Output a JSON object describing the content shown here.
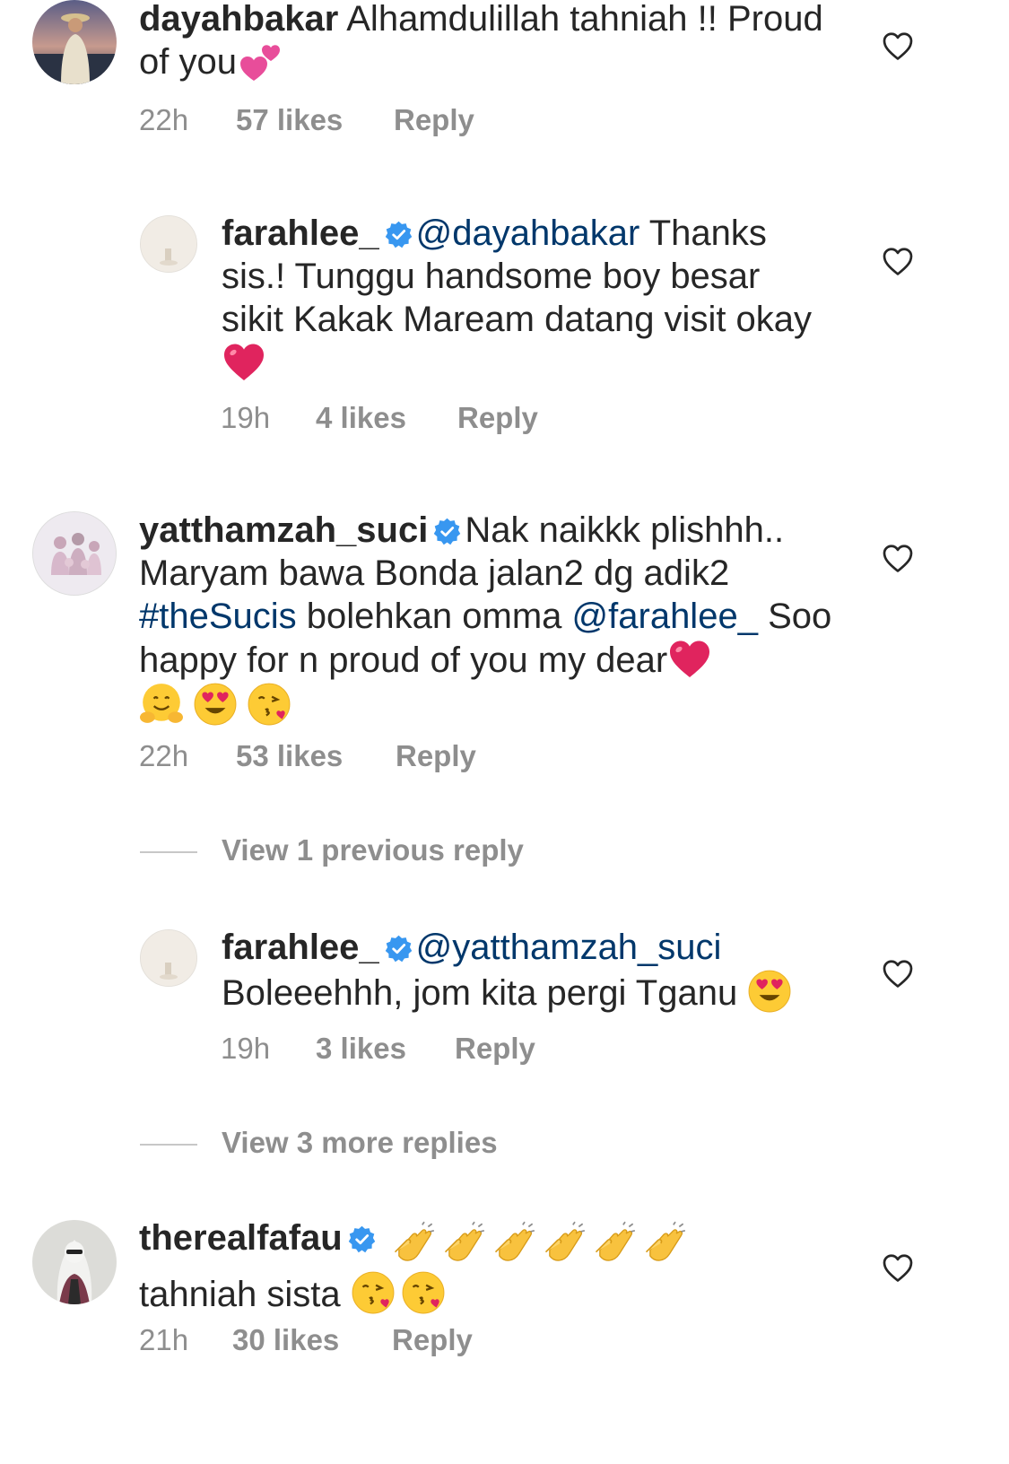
{
  "comments": [
    {
      "username": "dayahbakar",
      "text": "Alhamdulillah tahniah !! Proud of you",
      "time": "22h",
      "likes": "57 likes",
      "reply": "Reply"
    },
    {
      "username": "farahlee_",
      "mention": "@dayahbakar",
      "text": "Thanks sis.! Tunggu handsome boy besar sikit Kakak Maream datang visit okay",
      "time": "19h",
      "likes": "4 likes",
      "reply": "Reply"
    },
    {
      "username": "yatthamzah_suci",
      "text1": "Nak naikkk plishhh.. Maryam bawa Bonda jalan2 dg adik2",
      "hashtag": "#theSucis",
      "text2": "bolehkan omma",
      "mention": "@farahlee_",
      "text3": "Soo happy for n proud of you my dear",
      "time": "22h",
      "likes": "53 likes",
      "reply": "Reply"
    },
    {
      "username": "farahlee_",
      "mention": "@yatthamzah_suci",
      "text": "Boleeehhh, jom kita pergi Tganu",
      "time": "19h",
      "likes": "3 likes",
      "reply": "Reply"
    },
    {
      "username": "therealfafau",
      "text": "tahniah sista",
      "time": "21h",
      "likes": "30 likes",
      "reply": "Reply"
    }
  ],
  "view_previous": "View 1 previous reply",
  "view_more": "View 3 more replies",
  "colors": {
    "text": "#262626",
    "meta": "#8e8e8e",
    "link": "#00376b",
    "verified": "#3897f0",
    "heart_emoji": "#e0245e"
  }
}
